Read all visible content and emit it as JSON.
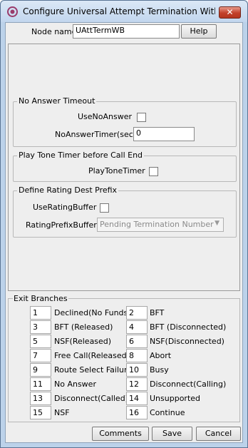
{
  "window": {
    "title": "Configure Universal Attempt Termination With Bil...",
    "close_label": "✕"
  },
  "header": {
    "node_name_label": "Node name",
    "node_name_value": "UAttTermWB",
    "help_label": "Help"
  },
  "no_answer": {
    "title": "No Answer Timeout",
    "use_label": "UseNoAnswer",
    "use_checked": false,
    "timer_label": "NoAnswerTimer(sec)",
    "timer_value": "0"
  },
  "play_tone": {
    "title": "Play Tone Timer before Call End",
    "label": "PlayToneTimer",
    "checked": false
  },
  "rating": {
    "title": "Define Rating Dest Prefix",
    "use_label": "UseRatingBuffer",
    "use_checked": false,
    "buffer_label": "RatingPrefixBuffer",
    "buffer_value": "Pending Termination Number"
  },
  "exit_branches": {
    "title": "Exit Branches",
    "items": [
      {
        "num": "1",
        "label": "Declined(No Funds)"
      },
      {
        "num": "2",
        "label": "BFT"
      },
      {
        "num": "3",
        "label": "BFT (Released)"
      },
      {
        "num": "4",
        "label": "BFT (Disconnected)"
      },
      {
        "num": "5",
        "label": "NSF(Released)"
      },
      {
        "num": "6",
        "label": "NSF(Disconnected)"
      },
      {
        "num": "7",
        "label": "Free Call(Released)"
      },
      {
        "num": "8",
        "label": "Abort"
      },
      {
        "num": "9",
        "label": "Route Select Failure"
      },
      {
        "num": "10",
        "label": "Busy"
      },
      {
        "num": "11",
        "label": "No Answer"
      },
      {
        "num": "12",
        "label": "Disconnect(Calling)"
      },
      {
        "num": "13",
        "label": "Disconnect(Called)"
      },
      {
        "num": "14",
        "label": "Unsupported"
      },
      {
        "num": "15",
        "label": "NSF"
      },
      {
        "num": "16",
        "label": "Continue"
      }
    ]
  },
  "footer": {
    "comments_label": "Comments",
    "save_label": "Save",
    "cancel_label": "Cancel"
  },
  "icons": {
    "app": "target-icon",
    "close": "close-icon",
    "dropdown": "chevron-down-icon"
  }
}
